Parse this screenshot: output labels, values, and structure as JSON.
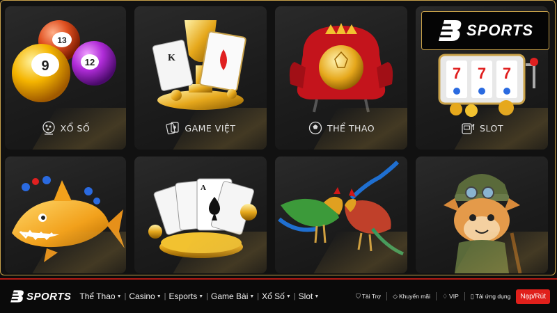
{
  "brand": {
    "name": "SPORTS"
  },
  "tiles": [
    {
      "label": "XỔ SỐ",
      "icon": "lottery-ball-icon"
    },
    {
      "label": "GAME VIỆT",
      "icon": "playing-cards-icon"
    },
    {
      "label": "THỂ THAO",
      "icon": "football-icon"
    },
    {
      "label": "SLOT",
      "icon": "slot-machine-icon"
    },
    {
      "label": "",
      "icon": "fish-shooting-art"
    },
    {
      "label": "",
      "icon": "card-game-art"
    },
    {
      "label": "",
      "icon": "cockfight-art"
    },
    {
      "label": "",
      "icon": "esports-character-art"
    }
  ],
  "art_text": {
    "ball_13": "13",
    "ball_9": "9",
    "ball_12": "12",
    "card_k": "K",
    "card_a": "A",
    "slot_7": "7"
  },
  "nav": {
    "menu": [
      {
        "label": "Thể Thao"
      },
      {
        "label": "Casino"
      },
      {
        "label": "Esports"
      },
      {
        "label": "Game Bài"
      },
      {
        "label": "Xổ Số"
      },
      {
        "label": "Slot"
      }
    ],
    "links": [
      {
        "label": "Tài Trợ",
        "icon": "shield-icon"
      },
      {
        "label": "Khuyến mãi",
        "icon": "tag-icon"
      },
      {
        "label": "VIP",
        "icon": "diamond-icon"
      },
      {
        "label": "Tải ứng dụng",
        "icon": "phone-icon"
      }
    ],
    "deposit_label": "Nạp/Rút"
  },
  "colors": {
    "accent_gold": "#c9a24a",
    "nav_red": "#e0201b",
    "background": "#0c0c0c"
  }
}
